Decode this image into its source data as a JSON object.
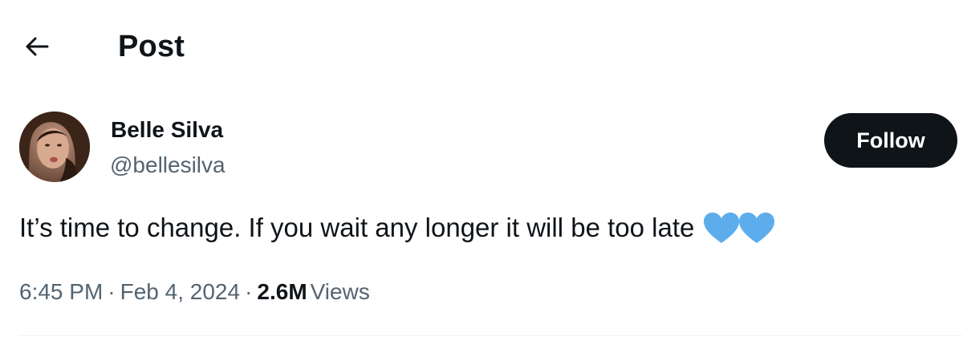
{
  "header": {
    "back_icon": "arrow-left-icon",
    "title": "Post"
  },
  "author": {
    "name": "Belle Silva",
    "handle": "@bellesilva",
    "avatar": "profile-photo"
  },
  "follow_button": {
    "label": "Follow",
    "background": "#0f1419",
    "text_color": "#ffffff"
  },
  "post": {
    "text": "It’s time to change. If you wait any longer it will be too late",
    "emoji": [
      "blue-heart-icon",
      "blue-heart-icon"
    ],
    "emoji_color": "#5dadec"
  },
  "meta": {
    "time": "6:45 PM",
    "separator": "·",
    "date": "Feb 4, 2024",
    "views_count": "2.6M",
    "views_label": "Views"
  },
  "colors": {
    "primary_text": "#0f1419",
    "secondary_text": "#536471",
    "divider": "#eff3f4"
  }
}
